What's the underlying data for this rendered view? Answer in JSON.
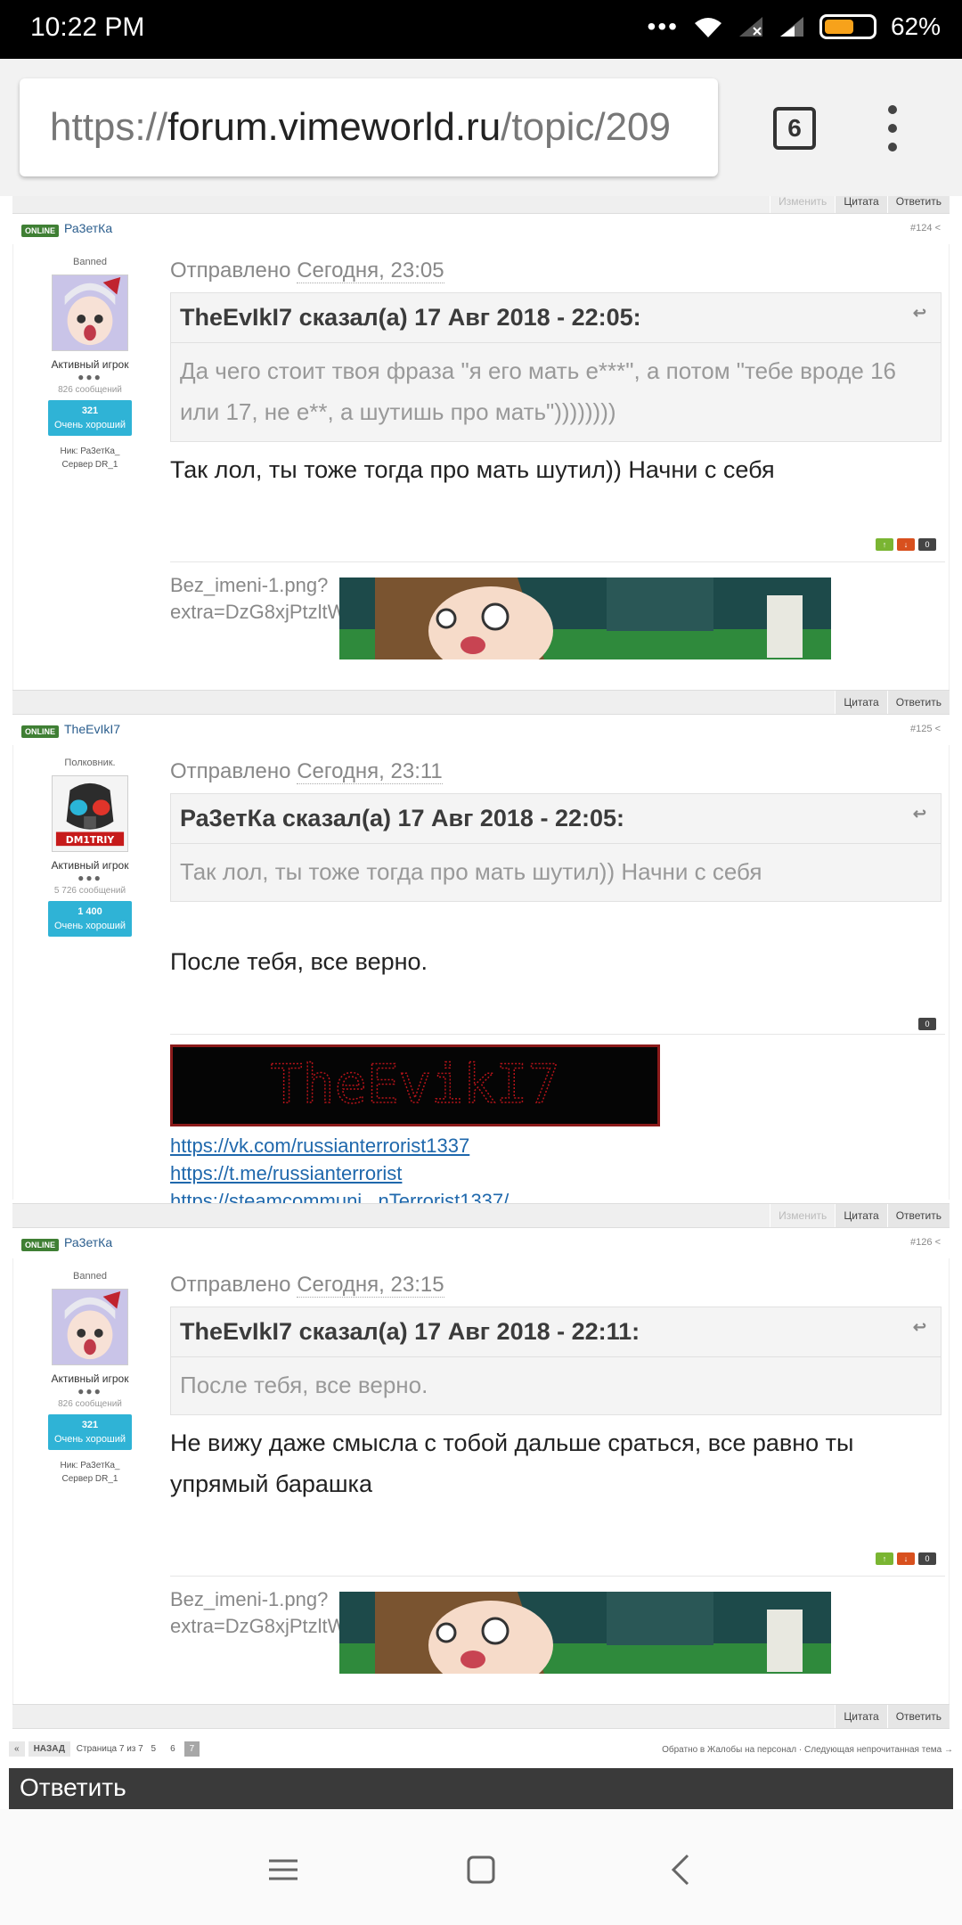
{
  "status": {
    "time": "10:22 PM",
    "dots": "•••",
    "battery": "62%",
    "battery_level": 0.62
  },
  "browser": {
    "url_prefix": "https://",
    "url_host": "forum.vimeworld.ru",
    "url_path": "/topic/209",
    "tab_count": "6"
  },
  "top_bar": {
    "edit": "Изменить",
    "quote": "Цитата",
    "reply": "Ответить"
  },
  "posts": [
    {
      "online": "ONLINE",
      "author": "Ра3етКа",
      "num": "#124",
      "title": "Banned",
      "rank": "Активный игрок",
      "pips": "●●●",
      "count": "826 сообщений",
      "rep_value": "321",
      "rep_label": "Очень хороший",
      "nick": "Ник: Ра3етКа_",
      "server": "Сервер DR_1",
      "sent_prefix": "Отправлено",
      "sent_date": "Сегодня, 23:05",
      "quote_head": "TheEvIkI7 сказал(а) 17 Авг 2018 - 22:05:",
      "quote_body": "Да чего стоит твоя фраза \"я его мать е***\", а потом \"тебе вроде 16 или 17, не е**, а шутишь про мать\"))))))))",
      "text": "Так лол, ты тоже тогда про мать шутил)) Начни с себя",
      "rating": {
        "up": "↑",
        "down": "↓",
        "score": "0"
      },
      "broken_img": "Bez_imeni-1.png?extra=DzG8xjPtzltW",
      "bar": {
        "quote": "Цитата",
        "reply": "Ответить"
      }
    },
    {
      "online": "ONLINE",
      "author": "TheEvIkI7",
      "num": "#125",
      "title": "Полковник.",
      "rank": "Активный игрок",
      "pips": "●●●",
      "count": "5 726 сообщений",
      "rep_value": "1 400",
      "rep_label": "Очень хороший",
      "avatar_label": "DM1TRIY",
      "sent_prefix": "Отправлено",
      "sent_date": "Сегодня, 23:11",
      "quote_head": "Ра3етКа сказал(а) 17 Авг 2018 - 22:05:",
      "quote_body": "Так лол, ты тоже тогда про мать шутил)) Начни с себя",
      "text": "После тебя, все верно.",
      "rating": {
        "score": "0"
      },
      "sig_text": "TheEvikI7",
      "links": [
        "https://vk.com/russianterrorist1337",
        "https://t.me/russianterrorist",
        "https://steamcommuni...nTerrorist1337/"
      ],
      "bar": {
        "edit": "Изменить",
        "quote": "Цитата",
        "reply": "Ответить"
      }
    },
    {
      "online": "ONLINE",
      "author": "Ра3етКа",
      "num": "#126",
      "title": "Banned",
      "rank": "Активный игрок",
      "pips": "●●●",
      "count": "826 сообщений",
      "rep_value": "321",
      "rep_label": "Очень хороший",
      "nick": "Ник: Ра3етКа_",
      "server": "Сервер DR_1",
      "sent_prefix": "Отправлено",
      "sent_date": "Сегодня, 23:15",
      "quote_head": "TheEvIkI7 сказал(а) 17 Авг 2018 - 22:11:",
      "quote_body": "После тебя, все верно.",
      "text": "Не вижу даже смысла с тобой дальше сраться, все равно ты упрямый барашка",
      "rating": {
        "up": "↑",
        "down": "↓",
        "score": "0"
      },
      "broken_img": "Bez_imeni-1.png?extra=DzG8xjPtzltW",
      "bar": {
        "quote": "Цитата",
        "reply": "Ответить"
      }
    }
  ],
  "pager": {
    "back": "НАЗАД",
    "label": "Страница 7 из 7",
    "pages": [
      "5",
      "6",
      "7"
    ],
    "right": "Обратно в Жалобы на персонал · Следующая непрочитанная тема →"
  },
  "reply_button": "Ответить",
  "colors": {
    "online": "#3f7f34",
    "rep": "#2fb3d6",
    "link": "#1f68ac",
    "author": "#2a5d8d"
  }
}
